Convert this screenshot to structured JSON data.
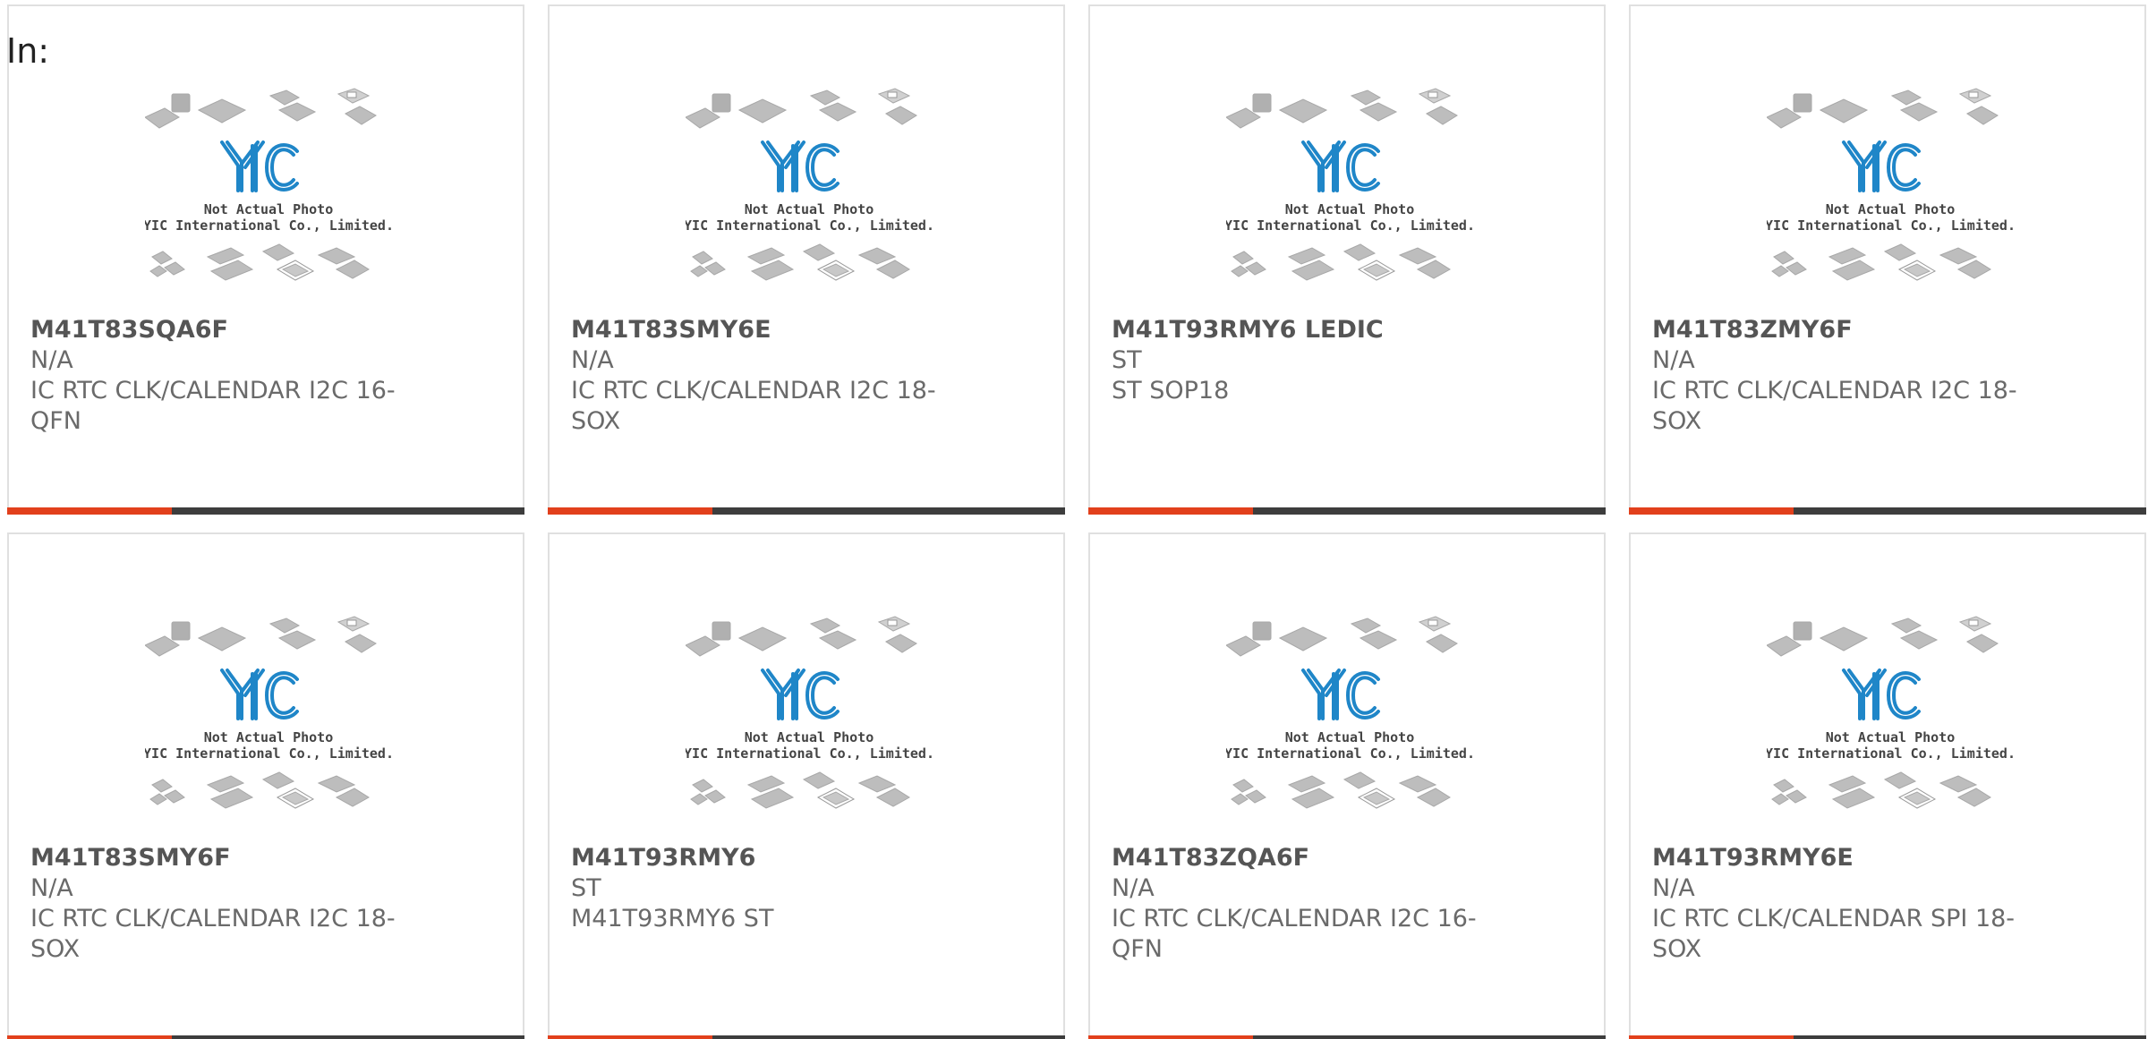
{
  "header": {
    "label": "In:"
  },
  "colors": {
    "accent": "#e2401c",
    "bar": "#3d3d3d",
    "logo": "#1f86c8"
  },
  "placeholder": {
    "line1": "Not Actual Photo",
    "line2": "YIC International Co., Limited.",
    "logo_text": "YIC"
  },
  "products": [
    {
      "part": "M41T83SQA6F",
      "maker": "N/A",
      "desc": "IC RTC CLK/CALENDAR I2C 16-QFN"
    },
    {
      "part": "M41T83SMY6E",
      "maker": "N/A",
      "desc": "IC RTC CLK/CALENDAR I2C 18-SOX"
    },
    {
      "part": "M41T93RMY6 LEDIC",
      "maker": "ST",
      "desc": "ST SOP18"
    },
    {
      "part": "M41T83ZMY6F",
      "maker": "N/A",
      "desc": "IC RTC CLK/CALENDAR I2C 18-SOX"
    },
    {
      "part": "M41T83SMY6F",
      "maker": "N/A",
      "desc": "IC RTC CLK/CALENDAR I2C 18-SOX"
    },
    {
      "part": "M41T93RMY6",
      "maker": "ST",
      "desc": "M41T93RMY6 ST"
    },
    {
      "part": "M41T83ZQA6F",
      "maker": "N/A",
      "desc": "IC RTC CLK/CALENDAR I2C 16-QFN"
    },
    {
      "part": "M41T93RMY6E",
      "maker": "N/A",
      "desc": "IC RTC CLK/CALENDAR SPI 18-SOX"
    }
  ]
}
